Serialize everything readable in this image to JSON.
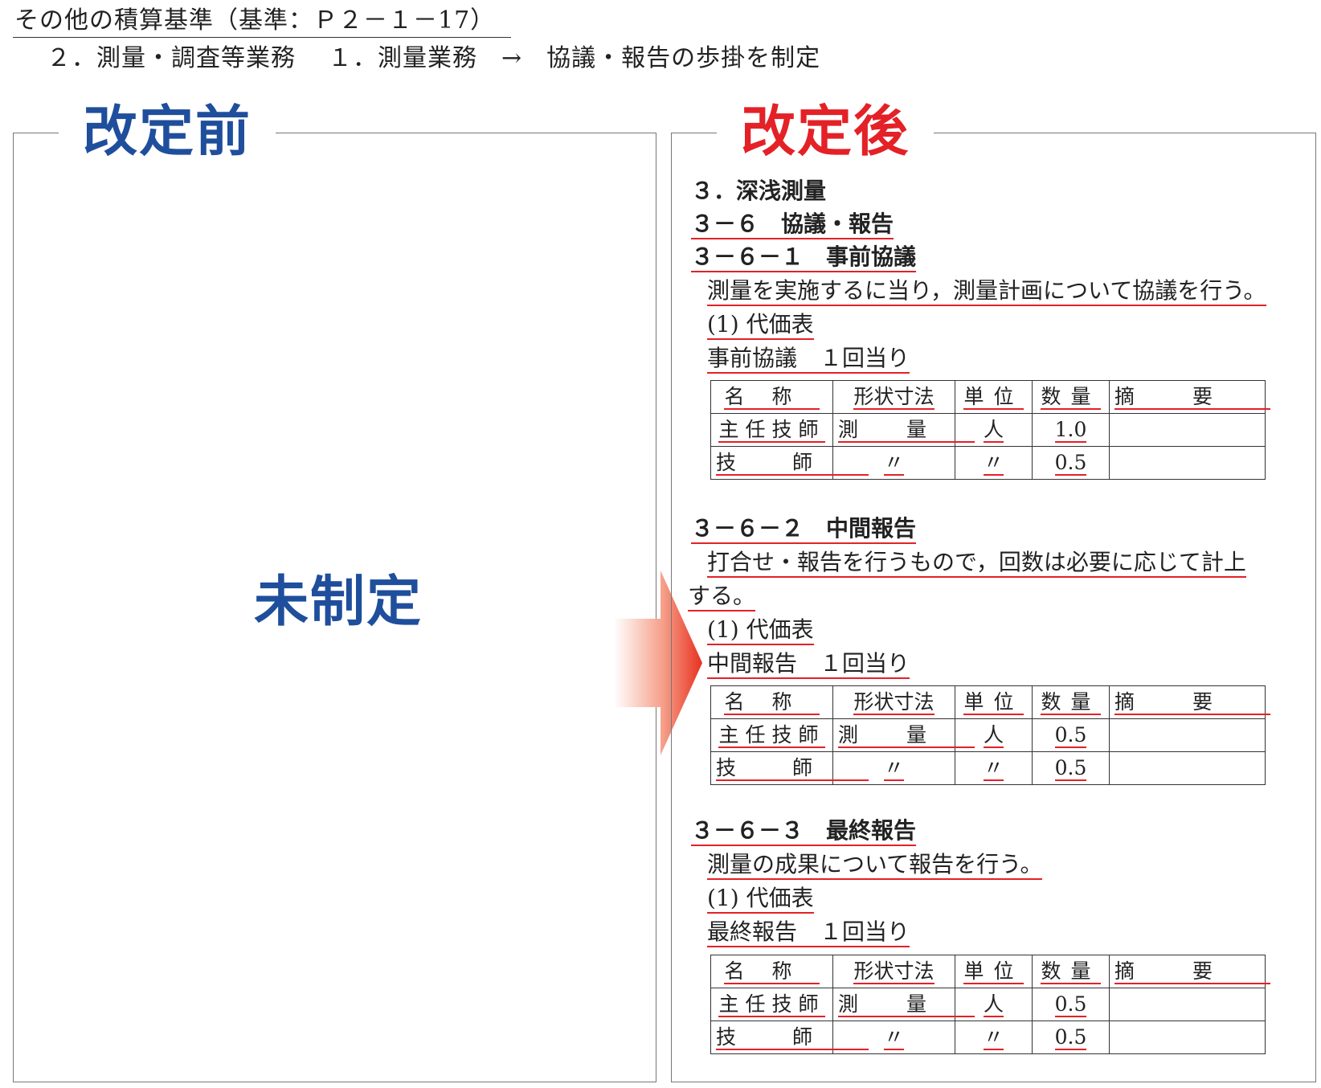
{
  "header": {
    "title": "その他の積算基準（基準：Ｐ２－１－17）",
    "breadcrumb_1": "２．測量・調査等業務",
    "breadcrumb_2": "１．測量業務",
    "arrow": "→",
    "breadcrumb_3": "協議・報告の歩掛を制定"
  },
  "before": {
    "title": "改定前",
    "status": "未制定"
  },
  "after": {
    "title": "改定後",
    "section": "３．深浅測量",
    "subsection": "３－６　協議・報告",
    "items": [
      {
        "heading": "３－６－１　事前協議",
        "description": "測量を実施するに当り，測量計画について協議を行う。",
        "price_label": "(1)  代価表",
        "unit_label": "事前協議　１回当り",
        "rows": [
          {
            "name": "主任技師",
            "spec": "測量",
            "unit": "人",
            "qty": "1.0",
            "note": ""
          },
          {
            "name": "技師",
            "spec": "〃",
            "unit": "〃",
            "qty": "0.5",
            "note": ""
          }
        ]
      },
      {
        "heading": "３－６－２　中間報告",
        "description": "打合せ・報告を行うもので，回数は必要に応じて計上",
        "description_cont": "する。",
        "price_label": "(1)  代価表",
        "unit_label": "中間報告　１回当り",
        "rows": [
          {
            "name": "主任技師",
            "spec": "測量",
            "unit": "人",
            "qty": "0.5",
            "note": ""
          },
          {
            "name": "技師",
            "spec": "〃",
            "unit": "〃",
            "qty": "0.5",
            "note": ""
          }
        ]
      },
      {
        "heading": "３－６－３　最終報告",
        "description": "測量の成果について報告を行う。",
        "price_label": "(1)  代価表",
        "unit_label": "最終報告　１回当り",
        "rows": [
          {
            "name": "主任技師",
            "spec": "測量",
            "unit": "人",
            "qty": "0.5",
            "note": ""
          },
          {
            "name": "技師",
            "spec": "〃",
            "unit": "〃",
            "qty": "0.5",
            "note": ""
          }
        ]
      }
    ],
    "table_headers": {
      "name": "名称",
      "spec": "形状寸法",
      "unit": "単位",
      "qty": "数量",
      "note": "摘要"
    }
  },
  "colors": {
    "before_blue": "#1f4e9c",
    "after_red": "#e32127",
    "underline_red": "#e32127",
    "arrow_red": "#e8311f"
  }
}
